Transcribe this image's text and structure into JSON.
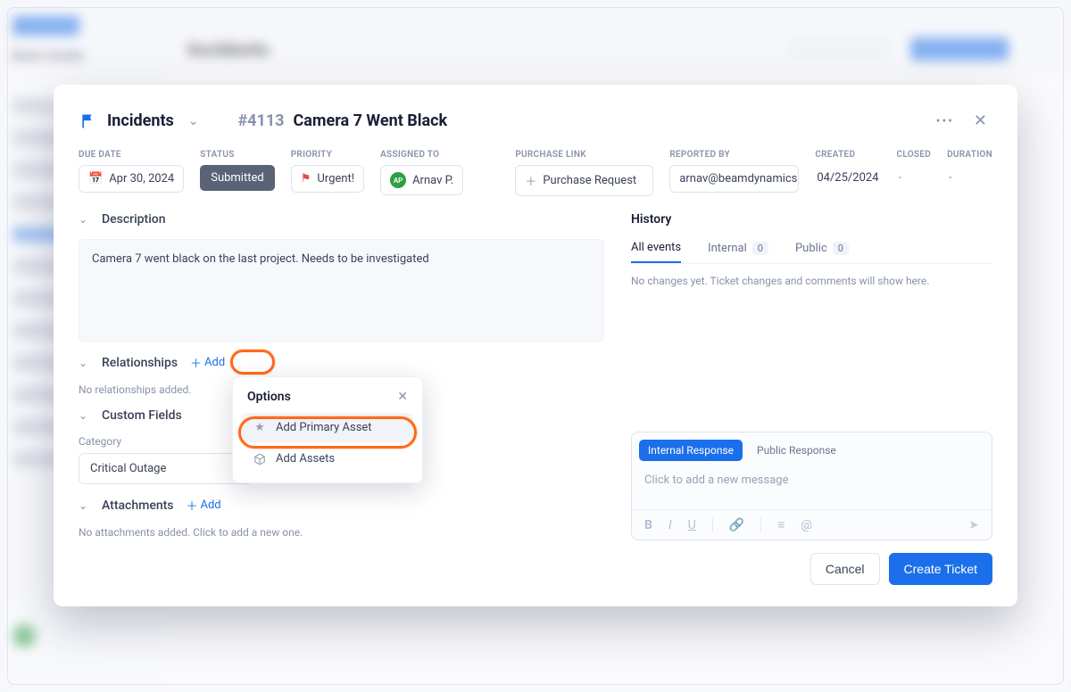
{
  "bg": {
    "workspace": "Beam Studio",
    "heading": "Incidents"
  },
  "header": {
    "category": "Incidents",
    "ticketId": "#4113",
    "title": "Camera 7 Went Black"
  },
  "fields": {
    "dueDate": {
      "label": "DUE DATE",
      "value": "Apr 30, 2024"
    },
    "status": {
      "label": "STATUS",
      "value": "Submitted"
    },
    "priority": {
      "label": "PRIORITY",
      "value": "Urgent!"
    },
    "assignedTo": {
      "label": "ASSIGNED TO",
      "value": "Arnav P.",
      "initials": "AP"
    },
    "purchaseLink": {
      "label": "PURCHASE LINK",
      "value": "Purchase Request"
    },
    "reportedBy": {
      "label": "REPORTED BY",
      "value": "arnav@beamdynamics.io"
    },
    "created": {
      "label": "CREATED",
      "value": "04/25/2024"
    },
    "closed": {
      "label": "CLOSED",
      "value": "-"
    },
    "duration": {
      "label": "DURATION",
      "value": "-"
    }
  },
  "sections": {
    "description": {
      "title": "Description",
      "text": "Camera 7 went black on the last project. Needs to be investigated"
    },
    "relationships": {
      "title": "Relationships",
      "addLabel": "Add",
      "empty": "No relationships added."
    },
    "customFields": {
      "title": "Custom Fields",
      "categoryLabel": "Category",
      "categoryValue": "Critical Outage"
    },
    "attachments": {
      "title": "Attachments",
      "addLabel": "Add",
      "empty": "No attachments added. Click to add a new one."
    }
  },
  "popover": {
    "title": "Options",
    "items": [
      {
        "label": "Add Primary Asset",
        "icon": "star"
      },
      {
        "label": "Add Assets",
        "icon": "cube"
      }
    ]
  },
  "history": {
    "title": "History",
    "tabs": {
      "all": "All events",
      "internal": "Internal",
      "internalCount": "0",
      "public": "Public",
      "publicCount": "0"
    },
    "empty": "No changes yet. Ticket changes and comments will show here."
  },
  "compose": {
    "tabs": {
      "internal": "Internal Response",
      "public": "Public Response"
    },
    "placeholder": "Click to add a new message"
  },
  "footer": {
    "cancel": "Cancel",
    "create": "Create Ticket"
  }
}
